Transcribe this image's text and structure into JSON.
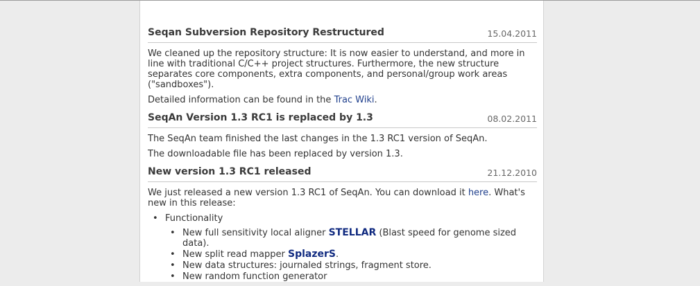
{
  "news": [
    {
      "title": "Seqan Subversion Repository Restructured",
      "date": "15.04.2011",
      "para1": "We cleaned up the repository structure: It is now easier to understand, and more in line with traditional C/C++ project structures. Furthermore, the new structure separates core components, extra components, and personal/group work areas (\"sandboxes\").",
      "para2_prefix": "Detailed information can be found in the ",
      "para2_link": "Trac Wiki",
      "para2_suffix": "."
    },
    {
      "title": "SeqAn Version 1.3 RC1 is replaced by 1.3",
      "date": "08.02.2011",
      "para1": "The SeqAn team finished the last changes in the 1.3 RC1 version of SeqAn.",
      "para2": "The downloadable file has been replaced by version 1.3."
    },
    {
      "title": "New version 1.3 RC1 released",
      "date": "21.12.2010",
      "para1_prefix": "We just released a new version 1.3 RC1 of SeqAn. You can download it ",
      "para1_link": "here",
      "para1_suffix": ". What's new in this release:",
      "functionality_label": "Functionality",
      "items": [
        {
          "prefix": "New full sensitivity local aligner ",
          "link": "STELLAR",
          "suffix": " (Blast speed for genome sized data)."
        },
        {
          "prefix": "New split read mapper ",
          "link": "SplazerS",
          "suffix": "."
        },
        {
          "text": "New data structures: journaled strings, fragment store."
        },
        {
          "text": "New random function generator"
        }
      ]
    }
  ]
}
